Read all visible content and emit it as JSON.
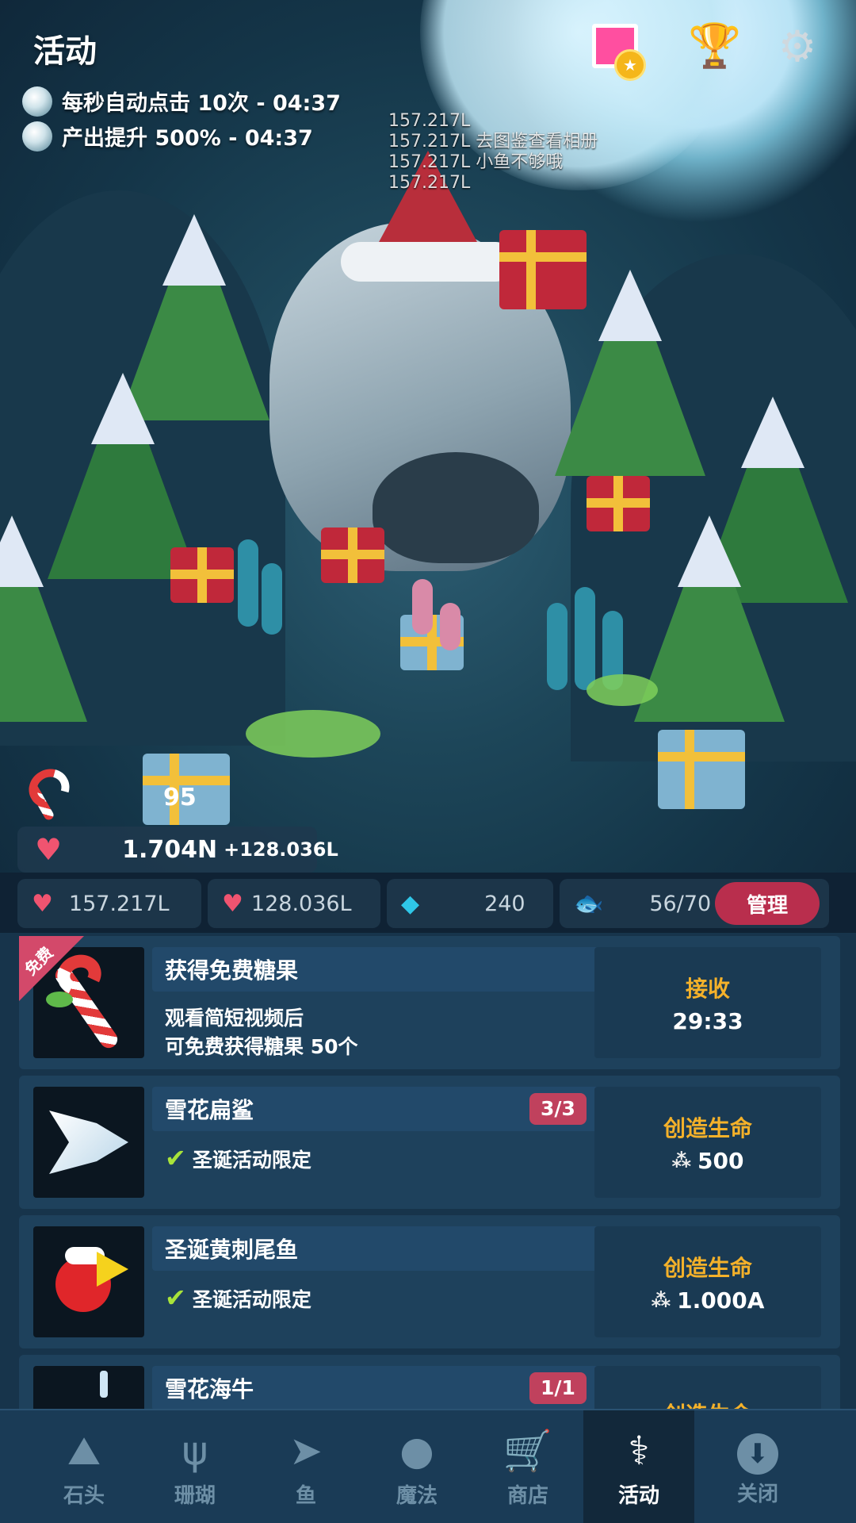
{
  "hud": {
    "title": "活动",
    "buffs": [
      {
        "text": "每秒自动点击 10次 - 04:37"
      },
      {
        "text": "产出提升 500%  - 04:37"
      }
    ],
    "icons": [
      "photo-album-icon",
      "trophy-icon",
      "gear-icon"
    ]
  },
  "scene": {
    "floating_lines": [
      "157.217L",
      "157.217L  去图鉴查看相册",
      "157.217L  小鱼不够哦",
      "157.217L"
    ]
  },
  "candy": {
    "count": "95"
  },
  "stats": {
    "hearts_total": "1.704N",
    "hearts_rate": "+128.036L",
    "tap_hearts": "157.217L",
    "idle_hearts": "128.036L",
    "gems": "240",
    "fish": "56/70",
    "manage_label": "管理"
  },
  "list": {
    "items": [
      {
        "ribbon": "免费",
        "name": "获得免费糖果",
        "desc_line1": "观看简短视频后",
        "desc_line2": "可免费获得糖果 50个",
        "action_label": "接收",
        "action_value": "29:33"
      },
      {
        "name": "雪花扁鲨",
        "badge": "3/3",
        "desc": "圣诞活动限定",
        "action_label": "创造生命",
        "action_value": "500"
      },
      {
        "name": "圣诞黄刺尾鱼",
        "desc": "圣诞活动限定",
        "action_label": "创造生命",
        "action_value": "1.000A"
      },
      {
        "name": "雪花海牛",
        "badge": "1/1",
        "action_label": "创造生命"
      }
    ]
  },
  "nav": {
    "items": [
      {
        "label": "石头",
        "icon": "rock-icon"
      },
      {
        "label": "珊瑚",
        "icon": "coral-icon"
      },
      {
        "label": "鱼",
        "icon": "fish-icon"
      },
      {
        "label": "魔法",
        "icon": "crystal-ball-icon"
      },
      {
        "label": "商店",
        "icon": "cart-icon"
      },
      {
        "label": "活动",
        "icon": "candy-cane-icon",
        "active": true
      },
      {
        "label": "关闭",
        "icon": "close-down-icon"
      }
    ]
  },
  "colors": {
    "accent_orange": "#f4b12a",
    "badge_red": "#c0415d",
    "manage_button": "#b92e4d",
    "heart": "#f05470",
    "gem": "#2fc7e8",
    "check": "#a8e33a"
  }
}
